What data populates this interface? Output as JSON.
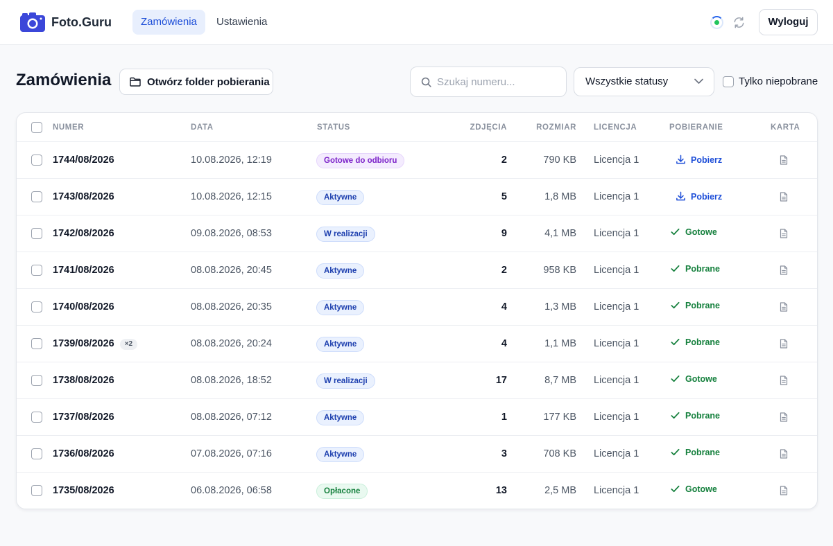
{
  "app": {
    "name": "Foto.Guru"
  },
  "nav": {
    "tabs": [
      {
        "label": "Zamówienia"
      },
      {
        "label": "Ustawienia"
      }
    ]
  },
  "header": {
    "logout_label": "Wyloguj"
  },
  "toolbar": {
    "title": "Zamówienia",
    "open_folder_label": "Otwórz folder pobierania",
    "search_placeholder": "Szukaj numeru...",
    "status_filter": "Wszystkie statusy",
    "only_not_downloaded_label": "Tylko niepobrane"
  },
  "table": {
    "columns": [
      "NUMER",
      "DATA",
      "STATUS",
      "ZDJĘCIA",
      "ROZMIAR",
      "LICENCJA",
      "POBIERANIE",
      "KARTA"
    ],
    "rows": [
      {
        "number": "1744/08/2026",
        "date": "10.08.2026, 12:19",
        "status": "Gotowe do odbioru",
        "status_type": "ready",
        "photos": "2",
        "size": "790 KB",
        "license": "Licencja 1",
        "download": "Pobierz",
        "download_type": "action"
      },
      {
        "number": "1743/08/2026",
        "date": "10.08.2026, 12:15",
        "status": "Aktywne",
        "status_type": "active",
        "photos": "5",
        "size": "1,8 MB",
        "license": "Licencja 1",
        "download": "Pobierz",
        "download_type": "action"
      },
      {
        "number": "1742/08/2026",
        "date": "09.08.2026, 08:53",
        "status": "W realizacji",
        "status_type": "progress",
        "photos": "9",
        "size": "4,1 MB",
        "license": "Licencja 1",
        "download": "Gotowe",
        "download_type": "done"
      },
      {
        "number": "1741/08/2026",
        "date": "08.08.2026, 20:45",
        "status": "Aktywne",
        "status_type": "active",
        "photos": "2",
        "size": "958 KB",
        "license": "Licencja 1",
        "download": "Pobrane",
        "download_type": "done"
      },
      {
        "number": "1740/08/2026",
        "date": "08.08.2026, 20:35",
        "status": "Aktywne",
        "status_type": "active",
        "photos": "4",
        "size": "1,3 MB",
        "license": "Licencja 1",
        "download": "Pobrane",
        "download_type": "done"
      },
      {
        "number": "1739/08/2026",
        "dup": "×2",
        "date": "08.08.2026, 20:24",
        "status": "Aktywne",
        "status_type": "active",
        "photos": "4",
        "size": "1,1 MB",
        "license": "Licencja 1",
        "download": "Pobrane",
        "download_type": "done"
      },
      {
        "number": "1738/08/2026",
        "date": "08.08.2026, 18:52",
        "status": "W realizacji",
        "status_type": "progress",
        "photos": "17",
        "size": "8,7 MB",
        "license": "Licencja 1",
        "download": "Gotowe",
        "download_type": "done"
      },
      {
        "number": "1737/08/2026",
        "date": "08.08.2026, 07:12",
        "status": "Aktywne",
        "status_type": "active",
        "photos": "1",
        "size": "177 KB",
        "license": "Licencja 1",
        "download": "Pobrane",
        "download_type": "done"
      },
      {
        "number": "1736/08/2026",
        "date": "07.08.2026, 07:16",
        "status": "Aktywne",
        "status_type": "active",
        "photos": "3",
        "size": "708 KB",
        "license": "Licencja 1",
        "download": "Pobrane",
        "download_type": "done"
      },
      {
        "number": "1735/08/2026",
        "date": "06.08.2026, 06:58",
        "status": "Opłacone",
        "status_type": "paid",
        "photos": "13",
        "size": "2,5 MB",
        "license": "Licencja 1",
        "download": "Gotowe",
        "download_type": "done"
      }
    ]
  },
  "colors": {
    "accent": "#1d4ed8",
    "active_tab_bg": "#e8effd",
    "badge_ready": [
      "#f4ecfe",
      "#e6d5fc",
      "#7c22c9"
    ],
    "badge_active": [
      "#eaf1fe",
      "#cddcfb",
      "#1e40af"
    ],
    "badge_progress": [
      "#eaf1fe",
      "#cddcfb",
      "#1e40af"
    ],
    "badge_paid": [
      "#e9f9f0",
      "#c9efdb",
      "#15803d"
    ],
    "done_green": "#15803d",
    "download_blue": "#1d4ed8"
  },
  "icons": [
    "camera-icon",
    "sync-status-icon",
    "refresh-icon",
    "folder-icon",
    "search-icon",
    "chevron-down-icon",
    "download-icon",
    "check-icon",
    "document-icon"
  ]
}
